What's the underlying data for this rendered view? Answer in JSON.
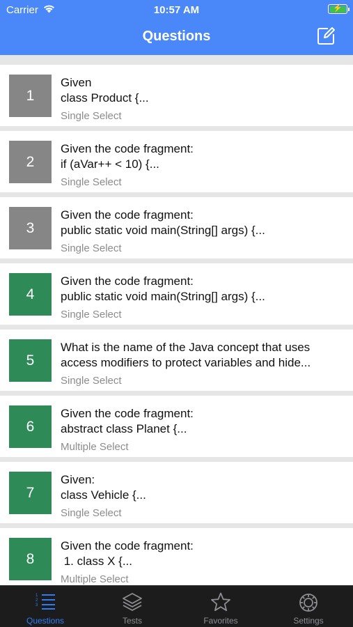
{
  "status_bar": {
    "carrier": "Carrier",
    "time": "10:57 AM",
    "battery_color": "#3ec24a"
  },
  "nav": {
    "title": "Questions",
    "compose_icon": "compose-icon",
    "background": "#4a87f8"
  },
  "questions": [
    {
      "number": "1",
      "line1": "Given",
      "line2": "class Product {...",
      "type": "Single Select",
      "status": "gray"
    },
    {
      "number": "2",
      "line1": "Given the code fragment:",
      "line2": "if (aVar++ < 10) {...",
      "type": "Single Select",
      "status": "gray"
    },
    {
      "number": "3",
      "line1": "Given the code fragment:",
      "line2": "public static void main(String[] args) {...",
      "type": "Single Select",
      "status": "gray"
    },
    {
      "number": "4",
      "line1": "Given the code fragment:",
      "line2": "public static void main(String[] args) {...",
      "type": "Single Select",
      "status": "green"
    },
    {
      "number": "5",
      "line1": "What is the name of the Java concept that uses",
      "line2": "access modifiers to protect variables and hide...",
      "type": "Single Select",
      "status": "green"
    },
    {
      "number": "6",
      "line1": "Given the code fragment:",
      "line2": "abstract class Planet {...",
      "type": "Multiple Select",
      "status": "green"
    },
    {
      "number": "7",
      "line1": "Given:",
      "line2": "class Vehicle {...",
      "type": "Single Select",
      "status": "green"
    },
    {
      "number": "8",
      "line1": "Given the code fragment:",
      "line2": " 1. class X {...",
      "type": "Multiple Select",
      "status": "green"
    }
  ],
  "colors": {
    "gray": "#868686",
    "green": "#2e8b57",
    "active_tab": "#2f7cf6"
  },
  "tabs": [
    {
      "label": "Questions",
      "icon": "list-icon",
      "active": true
    },
    {
      "label": "Tests",
      "icon": "layers-icon",
      "active": false
    },
    {
      "label": "Favorites",
      "icon": "star-icon",
      "active": false
    },
    {
      "label": "Settings",
      "icon": "gear-icon",
      "active": false
    }
  ]
}
